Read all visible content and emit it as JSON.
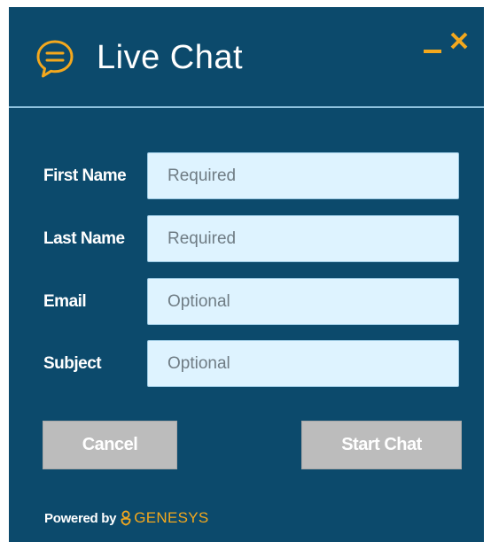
{
  "header": {
    "title": "Live Chat",
    "icon": "chat-bubble-icon",
    "minimize_icon": "minimize-icon",
    "close_icon": "close-icon"
  },
  "form": {
    "fields": [
      {
        "label": "First Name",
        "value": "",
        "placeholder": "Required"
      },
      {
        "label": "Last Name",
        "value": "",
        "placeholder": "Required"
      },
      {
        "label": "Email",
        "value": "",
        "placeholder": "Optional"
      },
      {
        "label": "Subject",
        "value": "",
        "placeholder": "Optional"
      }
    ]
  },
  "buttons": {
    "cancel_label": "Cancel",
    "start_label": "Start Chat"
  },
  "footer": {
    "powered_by": "Powered by",
    "brand": "GENESYS",
    "brand_icon": "genesys-logo-icon"
  },
  "colors": {
    "panel_background": "#0c4a6c",
    "accent": "#f4a81d",
    "input_background": "#def3ff",
    "button_disabled": "#bcbcbc",
    "divider": "#8fc2de",
    "text": "#ffffff"
  }
}
